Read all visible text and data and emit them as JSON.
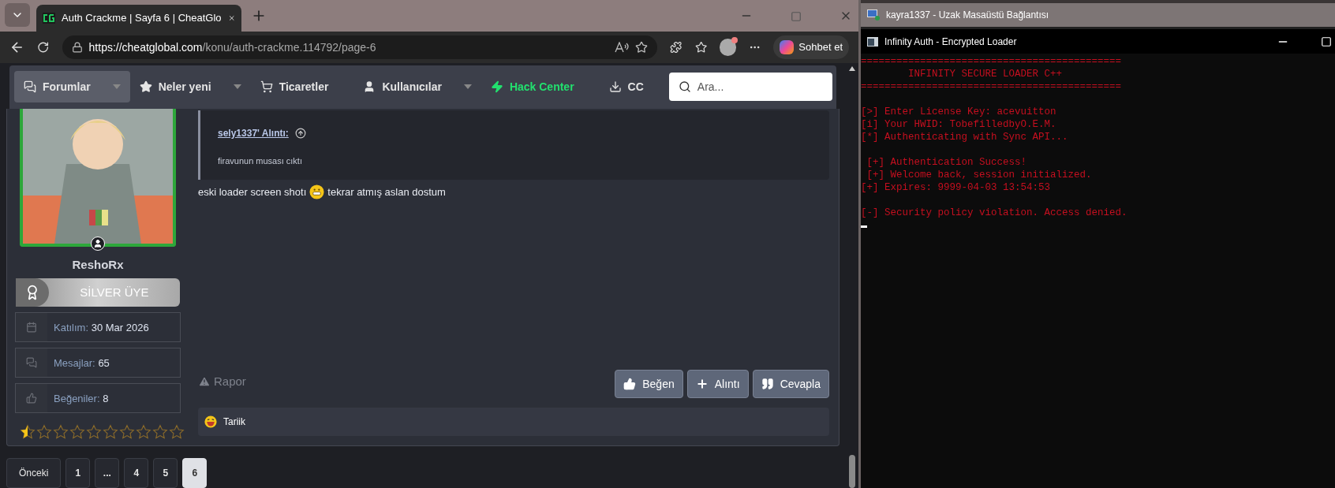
{
  "browser": {
    "tab_title": "Auth Crackme | Sayfa 6 | CheatGlo",
    "url_host": "https://cheatglobal.com",
    "url_path": "/konu/auth-crackme.114792/page-6",
    "copilot_label": "Sohbet et"
  },
  "nav": {
    "items": [
      {
        "label": "Forumlar",
        "selected": true,
        "dropdown": true,
        "accent": false
      },
      {
        "label": "Neler yeni",
        "selected": false,
        "dropdown": true,
        "accent": false
      },
      {
        "label": "Ticaretler",
        "selected": false,
        "dropdown": false,
        "accent": false
      },
      {
        "label": "Kullanıcılar",
        "selected": false,
        "dropdown": true,
        "accent": false
      },
      {
        "label": "Hack Center",
        "selected": false,
        "dropdown": false,
        "accent": true
      },
      {
        "label": "CC",
        "selected": false,
        "dropdown": false,
        "accent": false
      }
    ],
    "search": {
      "placeholder": "Ara..."
    }
  },
  "user": {
    "name": "ReshoRx",
    "rank": "SİLVER ÜYE",
    "stats": [
      {
        "label": "Katılım:",
        "value": "30 Mar 2026"
      },
      {
        "label": "Mesajlar:",
        "value": "65"
      },
      {
        "label": "Beğeniler:",
        "value": "8"
      }
    ],
    "stars": 0.5
  },
  "post": {
    "quote": {
      "author": "sely1337' Alıntı:",
      "text": "firavunun musası cıktı"
    },
    "body_before": "eski loader screen shotı",
    "body_after": "tekrar atmış aslan dostum",
    "report": "Rapor",
    "actions": [
      "Beğen",
      "Alıntı",
      "Cevapla"
    ],
    "reactor": "Tariik"
  },
  "pagination": [
    {
      "label": "Önceki",
      "selected": false
    },
    {
      "label": "1",
      "selected": false
    },
    {
      "label": "...",
      "selected": false
    },
    {
      "label": "4",
      "selected": false
    },
    {
      "label": "5",
      "selected": false
    },
    {
      "label": "6",
      "selected": true
    }
  ],
  "remote_window": {
    "title": "kayra1337 - Uzak Masaüstü Bağlantısı",
    "console_title": "Infinity Auth - Encrypted Loader",
    "lines": [
      {
        "lines": [
          "============================================",
          "        INFINITY SECURE LOADER C++",
          "============================================"
        ]
      },
      {
        "lines": [
          "[>] Enter License Key: acevuitton",
          "[i] Your HWID: TobefilledbyO.E.M.",
          "[*] Authenticating with Sync API..."
        ]
      },
      {
        "lines": [
          " [+] Authentication Success!",
          " [+] Welcome back, session initialized.",
          "[+] Expires: 9999-04-03 13:54:53"
        ]
      },
      {
        "lines": [
          "[-] Security policy violation. Access denied."
        ]
      }
    ]
  }
}
